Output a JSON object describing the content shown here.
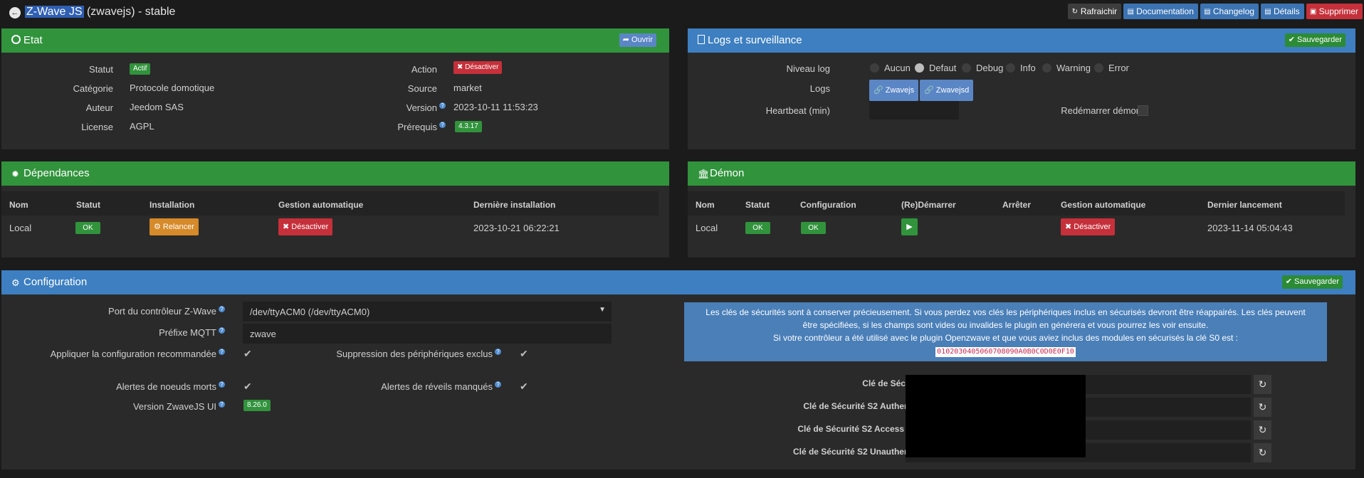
{
  "header": {
    "title_hl": "Z-Wave JS",
    "title_rest": " (zwavejs) - stable"
  },
  "topbuttons": [
    {
      "label": "Rafraichir",
      "icon": "refresh-icon"
    },
    {
      "label": "Documentation",
      "icon": "book-icon"
    },
    {
      "label": "Changelog",
      "icon": "book-icon"
    },
    {
      "label": "Détails",
      "icon": "book-icon"
    },
    {
      "label": "Supprimer",
      "icon": "trash-icon"
    }
  ],
  "etat": {
    "title": "Etat",
    "open": "Ouvrir",
    "statut_label": "Statut",
    "statut": "Actif",
    "categorie_label": "Catégorie",
    "categorie": "Protocole domotique",
    "auteur_label": "Auteur",
    "auteur": "Jeedom SAS",
    "license_label": "License",
    "license": "AGPL",
    "action_label": "Action",
    "action": "Désactiver",
    "source_label": "Source",
    "source": "market",
    "version_label": "Version",
    "version": "2023-10-11 11:53:23",
    "prerequis_label": "Prérequis",
    "prerequis": "4.3.17"
  },
  "logs": {
    "title": "Logs et surveillance",
    "save": "Sauvegarder",
    "niveau_label": "Niveau log",
    "levels": [
      "Aucun",
      "Defaut",
      "Debug",
      "Info",
      "Warning",
      "Error"
    ],
    "selected": "Defaut",
    "logs_label": "Logs",
    "log_buttons": [
      "Zwavejs",
      "Zwavejsd"
    ],
    "heartbeat_label": "Heartbeat (min)",
    "restart_label": "Redémarrer démon"
  },
  "deps": {
    "title": "Dépendances",
    "headers": [
      "Nom",
      "Statut",
      "Installation",
      "Gestion automatique",
      "Dernière installation"
    ],
    "row": {
      "nom": "Local",
      "statut": "OK",
      "installation": "Relancer",
      "gestion": "Désactiver",
      "derniere": "2023-10-21 06:22:21"
    }
  },
  "demon": {
    "title": "Démon",
    "headers": [
      "Nom",
      "Statut",
      "Configuration",
      "(Re)Démarrer",
      "Arrêter",
      "Gestion automatique",
      "Dernier lancement"
    ],
    "row": {
      "nom": "Local",
      "statut": "OK",
      "configuration": "OK",
      "gestion": "Désactiver",
      "dernier": "2023-11-14 05:04:43"
    }
  },
  "config": {
    "title": "Configuration",
    "save": "Sauvegarder",
    "port_label": "Port du contrôleur Z-Wave",
    "port_value": "/dev/ttyACM0 (/dev/ttyACM0)",
    "mqtt_label": "Préfixe MQTT",
    "mqtt_value": "zwave",
    "reco_label": "Appliquer la configuration recommandée",
    "suppr_label": "Suppression des périphériques exclus",
    "morts_label": "Alertes de noeuds morts",
    "reveils_label": "Alertes de réveils manqués",
    "zui_label": "Version ZwaveJS UI",
    "zui_value": "8.26.0",
    "info_line1": "Les clés de sécurités sont à conserver précieusement. Si vous perdez vos clés les périphériques inclus en sécurisés devront être réappairés. Les clés peuvent",
    "info_line2": "être spécifiées, si les champs sont vides ou invalides le plugin en générera et vous pourrez les voir ensuite.",
    "info_line3": "Si votre contrôleur a été utilisé avec le plugin Openzwave et que vous aviez inclus des modules en sécurisés la clé S0 est :",
    "info_code": "0102030405060708090A0B0C0D0E0F10",
    "keys": [
      "Clé de Sécurité S0",
      "Clé de Sécurité S2 Authenticated",
      "Clé de Sécurité S2 Access Control",
      "Clé de Sécurité S2 Unauthenticated"
    ]
  },
  "colors": {
    "green": "#31933c",
    "blue": "#3d7fc1",
    "red": "#c5303a",
    "orange": "#d68a29"
  }
}
